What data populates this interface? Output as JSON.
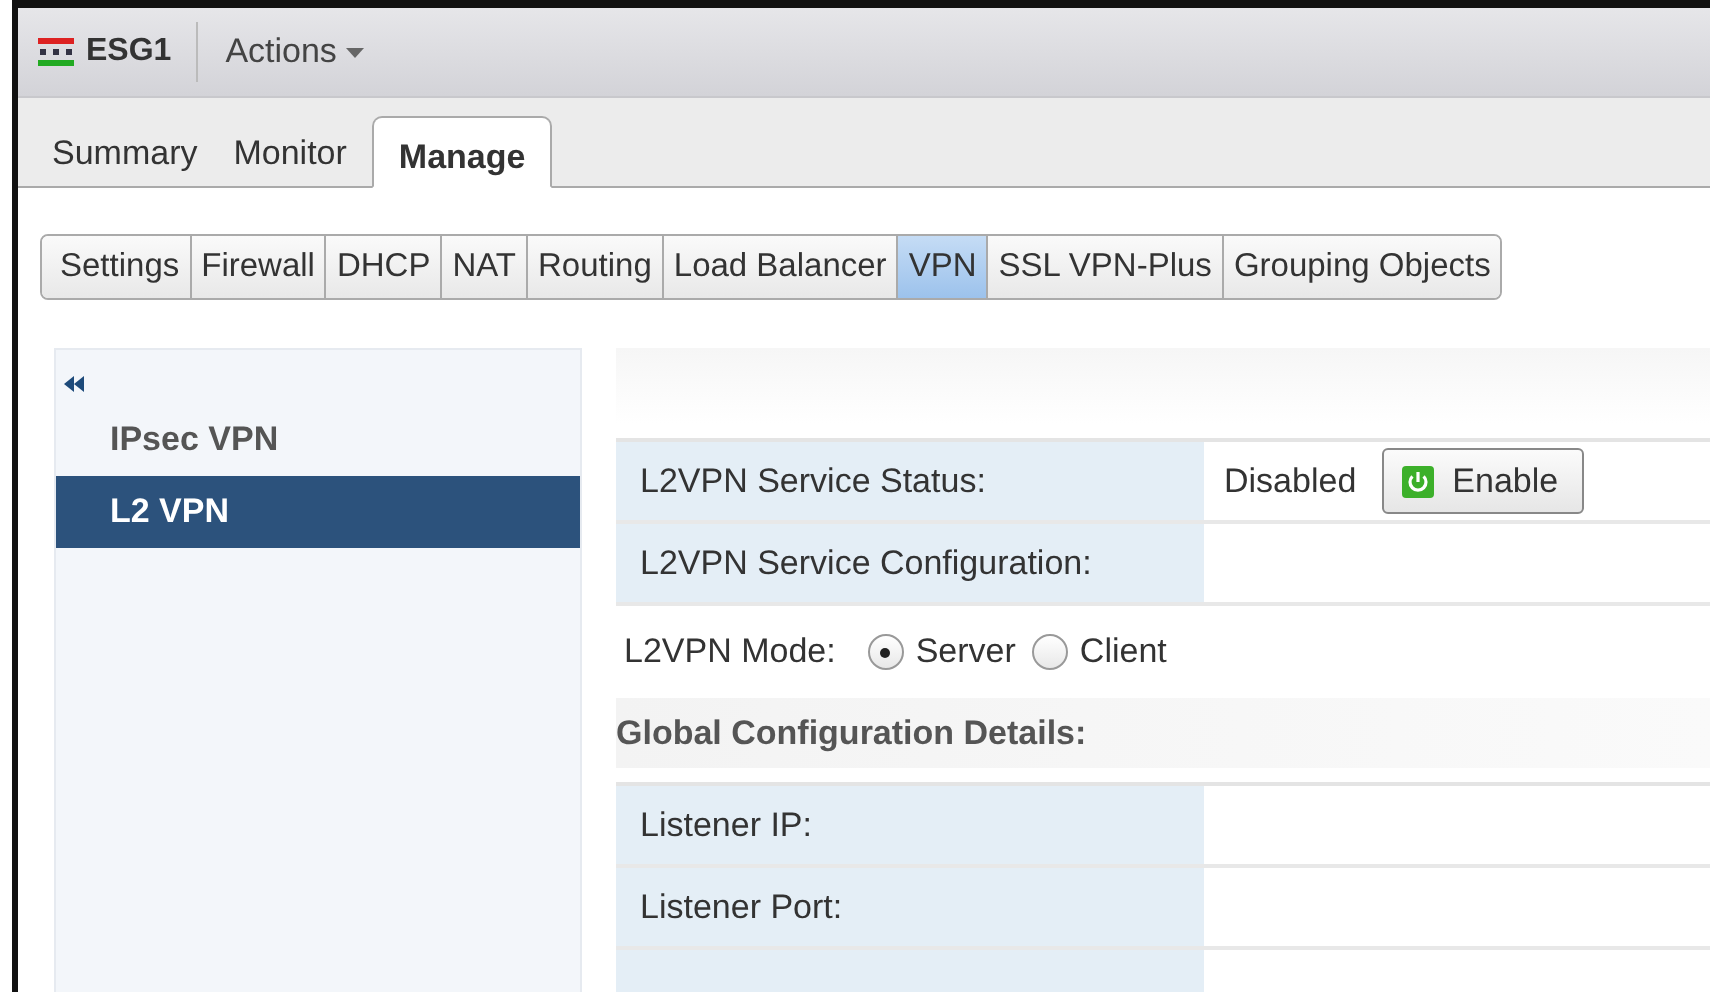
{
  "header": {
    "title": "ESG1",
    "actions": "Actions"
  },
  "tabs": [
    {
      "label": "Summary",
      "selected": false
    },
    {
      "label": "Monitor",
      "selected": false
    },
    {
      "label": "Manage",
      "selected": true
    }
  ],
  "subtabs": [
    {
      "label": "Settings",
      "selected": false
    },
    {
      "label": "Firewall",
      "selected": false
    },
    {
      "label": "DHCP",
      "selected": false
    },
    {
      "label": "NAT",
      "selected": false
    },
    {
      "label": "Routing",
      "selected": false
    },
    {
      "label": "Load Balancer",
      "selected": false
    },
    {
      "label": "VPN",
      "selected": true
    },
    {
      "label": "SSL VPN-Plus",
      "selected": false
    },
    {
      "label": "Grouping Objects",
      "selected": false
    }
  ],
  "sidebar": {
    "items": [
      {
        "label": "IPsec VPN",
        "selected": false
      },
      {
        "label": "L2 VPN",
        "selected": true
      }
    ]
  },
  "service_table": {
    "rows": [
      {
        "label": "L2VPN Service Status:",
        "value": "Disabled",
        "button": "Enable"
      },
      {
        "label": "L2VPN Service Configuration:"
      }
    ]
  },
  "mode": {
    "label": "L2VPN Mode:",
    "options": [
      {
        "label": "Server",
        "selected": true
      },
      {
        "label": "Client",
        "selected": false
      }
    ]
  },
  "global": {
    "heading": "Global Configuration Details:",
    "rows": [
      {
        "label": "Listener IP:"
      },
      {
        "label": "Listener Port:"
      }
    ]
  }
}
